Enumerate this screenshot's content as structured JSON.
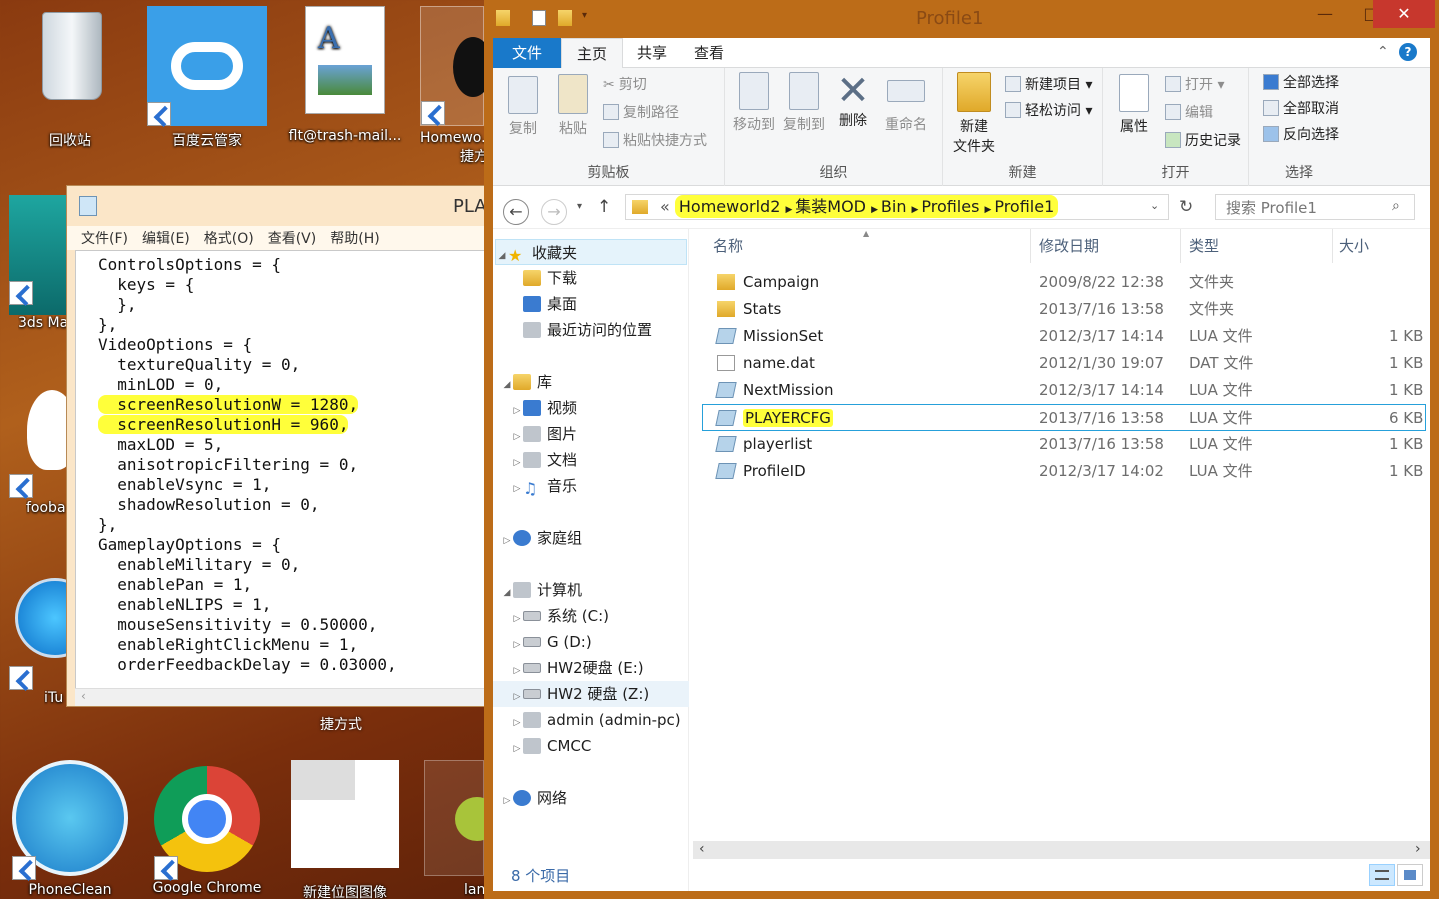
{
  "desktop": {
    "icons": [
      {
        "label": "回收站"
      },
      {
        "label": "百度云管家"
      },
      {
        "label": "flt@trash-mail..."
      },
      {
        "label": "Homewo...",
        "label2": "捷方"
      },
      {
        "label": "3ds Ma"
      },
      {
        "label": "fooba"
      },
      {
        "label": "iTu"
      },
      {
        "label": "捷方式"
      },
      {
        "label": "PhoneClean"
      },
      {
        "label": "Google Chrome"
      },
      {
        "label": "新建位图图像"
      },
      {
        "label": "lan"
      }
    ]
  },
  "notepad": {
    "title": "PLA",
    "menu": [
      "文件(F)",
      "编辑(E)",
      "格式(O)",
      "查看(V)",
      "帮助(H)"
    ],
    "lines": [
      "ControlsOptions = {",
      "  keys = {",
      "  },",
      "},",
      "VideoOptions = {",
      "  textureQuality = 0,",
      "  minLOD = 0,",
      "  screenResolutionW = 1280,",
      "  screenResolutionH = 960,",
      "  maxLOD = 5,",
      "  anisotropicFiltering = 0,",
      "  enableVsync = 1,",
      "  shadowResolution = 0,",
      "},",
      "GameplayOptions = {",
      "  enableMilitary = 0,",
      "  enablePan = 1,",
      "  enableNLIPS = 1,",
      "  mouseSensitivity = 0.50000,",
      "  enableRightClickMenu = 1,",
      "  orderFeedbackDelay = 0.03000,"
    ]
  },
  "explorer": {
    "title": "Profile1",
    "tabs": {
      "file": "文件",
      "home": "主页",
      "share": "共享",
      "view": "查看"
    },
    "ribbon": {
      "clipboard": {
        "copy": "复制",
        "paste": "粘贴",
        "cut": "剪切",
        "copy_path": "复制路径",
        "paste_shortcut": "粘贴快捷方式",
        "group": "剪贴板"
      },
      "organize": {
        "move_to": "移动到",
        "copy_to": "复制到",
        "delete": "删除",
        "rename": "重命名",
        "group": "组织"
      },
      "new": {
        "new_folder_1": "新建",
        "new_folder_2": "文件夹",
        "new_item": "新建项目",
        "easy_access": "轻松访问",
        "group": "新建"
      },
      "open": {
        "properties": "属性",
        "open": "打开",
        "edit": "编辑",
        "history": "历史记录",
        "group": "打开"
      },
      "select": {
        "select_all": "全部选择",
        "select_none": "全部取消",
        "invert": "反向选择",
        "group": "选择"
      }
    },
    "breadcrumb": [
      "«",
      "Homeworld2",
      "集装MOD",
      "Bin",
      "Profiles",
      "Profile1"
    ],
    "search_placeholder": "搜索 Profile1",
    "nav": {
      "favorites": "收藏夹",
      "downloads": "下载",
      "desktop": "桌面",
      "recent": "最近访问的位置",
      "libraries": "库",
      "videos": "视频",
      "pictures": "图片",
      "documents": "文档",
      "music": "音乐",
      "homegroup": "家庭组",
      "computer": "计算机",
      "drive_c": "系统 (C:)",
      "drive_d": "G (D:)",
      "drive_e": "HW2硬盘 (E:)",
      "drive_z": "HW2 硬盘 (Z:)",
      "admin": "admin (admin-pc)",
      "cmcc": "CMCC",
      "network": "网络"
    },
    "columns": {
      "name": "名称",
      "date": "修改日期",
      "type": "类型",
      "size": "大小"
    },
    "files": [
      {
        "name": "Campaign",
        "date": "2009/8/22 12:38",
        "type": "文件夹",
        "size": "",
        "kind": "folder"
      },
      {
        "name": "Stats",
        "date": "2013/7/16 13:58",
        "type": "文件夹",
        "size": "",
        "kind": "folder"
      },
      {
        "name": "MissionSet",
        "date": "2012/3/17 14:14",
        "type": "LUA 文件",
        "size": "1 KB",
        "kind": "lua"
      },
      {
        "name": "name.dat",
        "date": "2012/1/30 19:07",
        "type": "DAT 文件",
        "size": "1 KB",
        "kind": "dat"
      },
      {
        "name": "NextMission",
        "date": "2012/3/17 14:14",
        "type": "LUA 文件",
        "size": "1 KB",
        "kind": "lua"
      },
      {
        "name": "PLAYERCFG",
        "date": "2013/7/16 13:58",
        "type": "LUA 文件",
        "size": "6 KB",
        "kind": "lua"
      },
      {
        "name": "playerlist",
        "date": "2013/7/16 13:58",
        "type": "LUA 文件",
        "size": "1 KB",
        "kind": "lua"
      },
      {
        "name": "ProfileID",
        "date": "2012/3/17 14:02",
        "type": "LUA 文件",
        "size": "1 KB",
        "kind": "lua"
      }
    ],
    "status": "8 个项目",
    "colors": {
      "highlight": "#ffff3a",
      "file_tab": "#1979ca",
      "frame": "#bc6c18",
      "close": "#c7372d"
    }
  }
}
